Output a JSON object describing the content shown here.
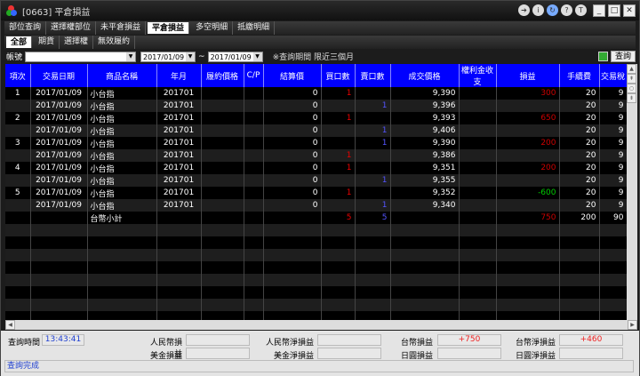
{
  "window": {
    "title": "[0663] 平倉損益"
  },
  "title_buttons": [
    "exit-icon",
    "info-icon",
    "refresh-icon",
    "help-icon",
    "pin-icon"
  ],
  "tabs": [
    {
      "label": "部位查詢"
    },
    {
      "label": "選擇權部位"
    },
    {
      "label": "未平倉損益"
    },
    {
      "label": "平倉損益",
      "active": true
    },
    {
      "label": "多空明細"
    },
    {
      "label": "抵繳明細"
    }
  ],
  "subtabs": [
    {
      "label": "全部",
      "active": true
    },
    {
      "label": "期貨"
    },
    {
      "label": "選擇權"
    },
    {
      "label": "無效履約"
    }
  ],
  "filter": {
    "account_label": "帳號",
    "date_from": "2017/01/09",
    "tilde": "~",
    "date_to": "2017/01/09",
    "note": "※查詢期間 限近三個月",
    "query_label": "查詢"
  },
  "columns": [
    "項次",
    "交易日期",
    "商品名稱",
    "年月",
    "履約價格",
    "C/P",
    "結算價",
    "買口數",
    "賣口數",
    "成交價格",
    "權利金收支",
    "損益",
    "手續費",
    "交易稅"
  ],
  "rows": [
    {
      "no": "1",
      "date": "2017/01/09",
      "name": "小台指",
      "ym": "201701",
      "strike": "",
      "cp": "",
      "settle": "0",
      "buy": "1",
      "sell": "",
      "price": "9,390",
      "premium": "",
      "pnl": "300",
      "pnl_color": "red",
      "fee": "20",
      "tax": "9"
    },
    {
      "no": "",
      "date": "2017/01/09",
      "name": "小台指",
      "ym": "201701",
      "strike": "",
      "cp": "",
      "settle": "0",
      "buy": "",
      "sell": "1",
      "price": "9,396",
      "premium": "",
      "pnl": "",
      "fee": "20",
      "tax": "9"
    },
    {
      "no": "2",
      "date": "2017/01/09",
      "name": "小台指",
      "ym": "201701",
      "strike": "",
      "cp": "",
      "settle": "0",
      "buy": "1",
      "sell": "",
      "price": "9,393",
      "premium": "",
      "pnl": "650",
      "pnl_color": "red",
      "fee": "20",
      "tax": "9"
    },
    {
      "no": "",
      "date": "2017/01/09",
      "name": "小台指",
      "ym": "201701",
      "strike": "",
      "cp": "",
      "settle": "0",
      "buy": "",
      "sell": "1",
      "price": "9,406",
      "premium": "",
      "pnl": "",
      "fee": "20",
      "tax": "9"
    },
    {
      "no": "3",
      "date": "2017/01/09",
      "name": "小台指",
      "ym": "201701",
      "strike": "",
      "cp": "",
      "settle": "0",
      "buy": "",
      "sell": "1",
      "price": "9,390",
      "premium": "",
      "pnl": "200",
      "pnl_color": "red",
      "fee": "20",
      "tax": "9"
    },
    {
      "no": "",
      "date": "2017/01/09",
      "name": "小台指",
      "ym": "201701",
      "strike": "",
      "cp": "",
      "settle": "0",
      "buy": "1",
      "sell": "",
      "price": "9,386",
      "premium": "",
      "pnl": "",
      "fee": "20",
      "tax": "9"
    },
    {
      "no": "4",
      "date": "2017/01/09",
      "name": "小台指",
      "ym": "201701",
      "strike": "",
      "cp": "",
      "settle": "0",
      "buy": "1",
      "sell": "",
      "price": "9,351",
      "premium": "",
      "pnl": "200",
      "pnl_color": "red",
      "fee": "20",
      "tax": "9"
    },
    {
      "no": "",
      "date": "2017/01/09",
      "name": "小台指",
      "ym": "201701",
      "strike": "",
      "cp": "",
      "settle": "0",
      "buy": "",
      "sell": "1",
      "price": "9,355",
      "premium": "",
      "pnl": "",
      "fee": "20",
      "tax": "9"
    },
    {
      "no": "5",
      "date": "2017/01/09",
      "name": "小台指",
      "ym": "201701",
      "strike": "",
      "cp": "",
      "settle": "0",
      "buy": "1",
      "sell": "",
      "price": "9,352",
      "premium": "",
      "pnl": "-600",
      "pnl_color": "green",
      "fee": "20",
      "tax": "9"
    },
    {
      "no": "",
      "date": "2017/01/09",
      "name": "小台指",
      "ym": "201701",
      "strike": "",
      "cp": "",
      "settle": "0",
      "buy": "",
      "sell": "1",
      "price": "9,340",
      "premium": "",
      "pnl": "",
      "fee": "20",
      "tax": "9"
    }
  ],
  "subtotal": {
    "name": "台幣小計",
    "buy": "5",
    "sell": "5",
    "pnl": "750",
    "fee": "200",
    "tax": "90"
  },
  "summary": {
    "query_time_label": "查詢時間",
    "query_time": "13:43:41",
    "rmb_pnl_label": "人民幣損益",
    "rmb_pnl": "",
    "rmb_net_label": "人民幣淨損益",
    "rmb_net": "",
    "twd_pnl_label": "台幣損益",
    "twd_pnl": "+750",
    "twd_net_label": "台幣淨損益",
    "twd_net": "+460",
    "usd_pnl_label": "美金損益",
    "usd_pnl": "",
    "usd_net_label": "美金淨損益",
    "usd_net": "",
    "jpy_pnl_label": "日圓損益",
    "jpy_pnl": "",
    "jpy_net_label": "日圓淨損益",
    "jpy_net": ""
  },
  "status": "查詢完成"
}
